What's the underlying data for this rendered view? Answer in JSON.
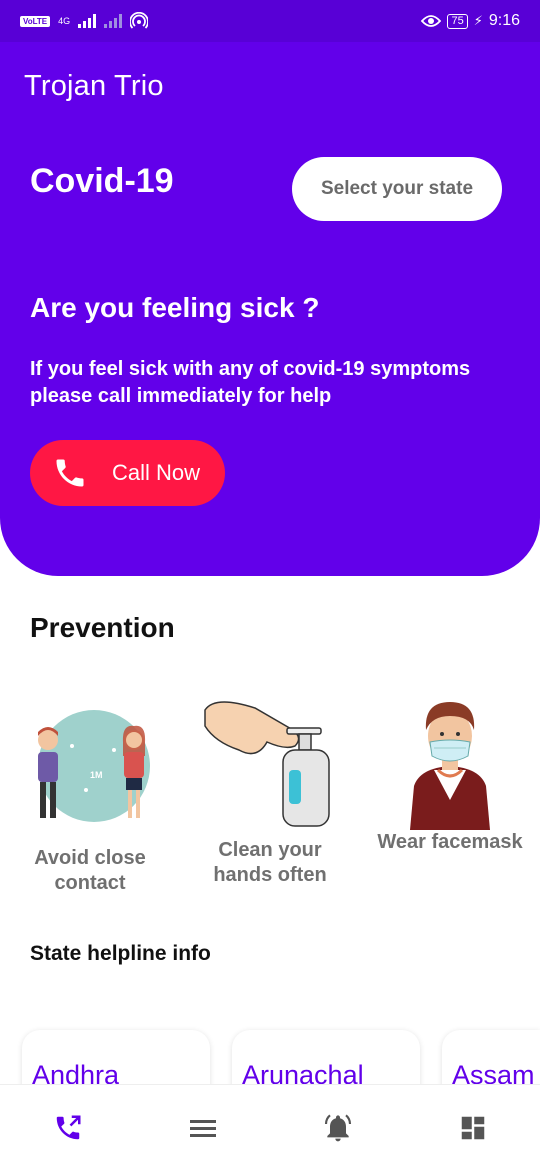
{
  "status_bar": {
    "volte": "VoLTE",
    "network": "4G",
    "battery": "75",
    "time": "9:16"
  },
  "app_bar": {
    "title": "Trojan Trio"
  },
  "hero": {
    "title": "Covid-19",
    "state_button": "Select your state",
    "sick_title": "Are you feeling sick ?",
    "sick_description": "If you feel sick with any of covid-19 symptoms please call immediately for help",
    "call_button": "Call Now"
  },
  "prevention": {
    "title": "Prevention",
    "items": [
      {
        "label": "Avoid close contact",
        "distance_label": "1M"
      },
      {
        "label": "Clean your hands often"
      },
      {
        "label": "Wear facemask"
      }
    ]
  },
  "helpline": {
    "title": "State helpline info",
    "states": [
      "Andhra",
      "Arunachal",
      "Assam"
    ]
  },
  "bottom_nav": {
    "items": [
      "phone-icon",
      "menu-icon",
      "notification-bell-icon",
      "dashboard-icon"
    ]
  },
  "colors": {
    "primary": "#6200ea",
    "status_bar": "#5800d6",
    "call_button": "#ff1744"
  }
}
